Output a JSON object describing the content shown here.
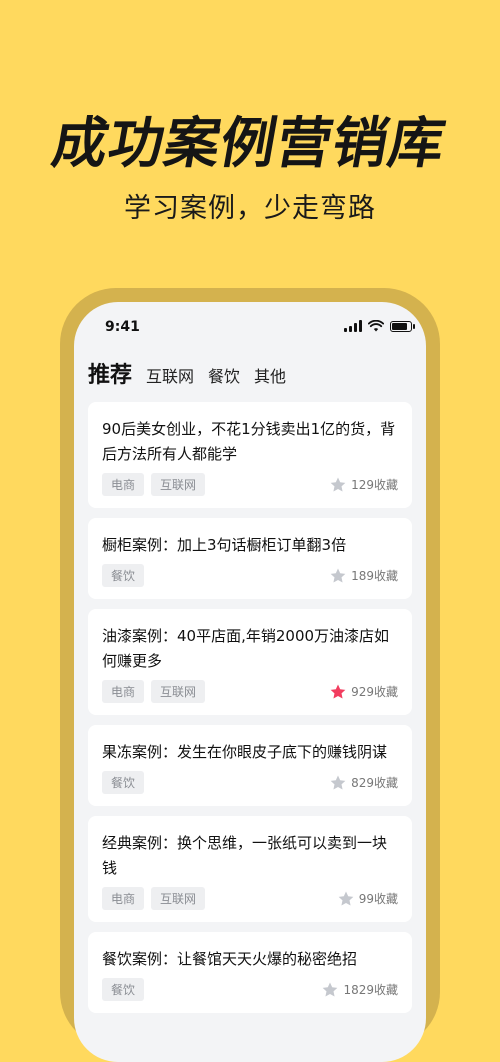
{
  "hero": {
    "title": "成功案例营销库",
    "subtitle": "学习案例，少走弯路"
  },
  "status_bar": {
    "time": "9:41"
  },
  "tabs": [
    {
      "label": "推荐",
      "active": true
    },
    {
      "label": "互联网",
      "active": false
    },
    {
      "label": "餐饮",
      "active": false
    },
    {
      "label": "其他",
      "active": false
    }
  ],
  "cards": [
    {
      "title": "90后美女创业，不花1分钱卖出1亿的货，背后方法所有人都能学",
      "tags": [
        "电商",
        "互联网"
      ],
      "favorites": "129收藏",
      "favorited": false
    },
    {
      "title": "橱柜案例：加上3句话橱柜订单翻3倍",
      "tags": [
        "餐饮"
      ],
      "favorites": "189收藏",
      "favorited": false
    },
    {
      "title": "油漆案例：40平店面,年销2000万油漆店如何赚更多",
      "tags": [
        "电商",
        "互联网"
      ],
      "favorites": "929收藏",
      "favorited": true
    },
    {
      "title": "果冻案例：发生在你眼皮子底下的赚钱阴谋",
      "tags": [
        "餐饮"
      ],
      "favorites": "829收藏",
      "favorited": false
    },
    {
      "title": "经典案例：换个思维，一张纸可以卖到一块钱",
      "tags": [
        "电商",
        "互联网"
      ],
      "favorites": "99收藏",
      "favorited": false
    },
    {
      "title": "餐饮案例：让餐馆天天火爆的秘密绝招",
      "tags": [
        "餐饮"
      ],
      "favorites": "1829收藏",
      "favorited": false
    }
  ],
  "colors": {
    "background": "#FFD95E",
    "star_active": "#F23D5F",
    "star_inactive": "#C5C8CE"
  }
}
